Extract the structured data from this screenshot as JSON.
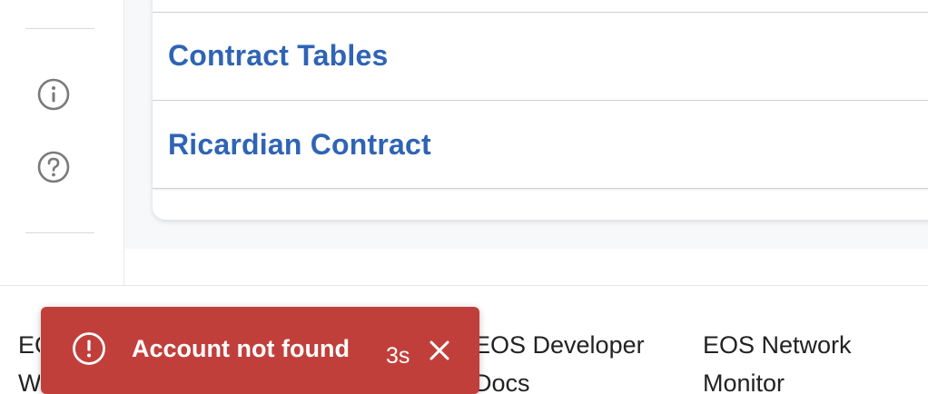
{
  "sidebar": {
    "icons": [
      "info-icon",
      "help-icon"
    ]
  },
  "card": {
    "menu_items": [
      {
        "label": "Contract Tables"
      },
      {
        "label": "Ricardian Contract"
      }
    ]
  },
  "footer": {
    "links": [
      {
        "label": "EOS Developer Docs"
      },
      {
        "label": "EOS Network Monitor"
      }
    ],
    "hidden_link_fragment": "EC\nW"
  },
  "toast": {
    "message": "Account not found",
    "timer": "3s",
    "icon": "alert-circle-icon",
    "close_icon": "close-icon"
  },
  "colors": {
    "link_blue": "#2f64b5",
    "toast_red": "#c13f3b",
    "background_gray": "#f7f8fa"
  }
}
